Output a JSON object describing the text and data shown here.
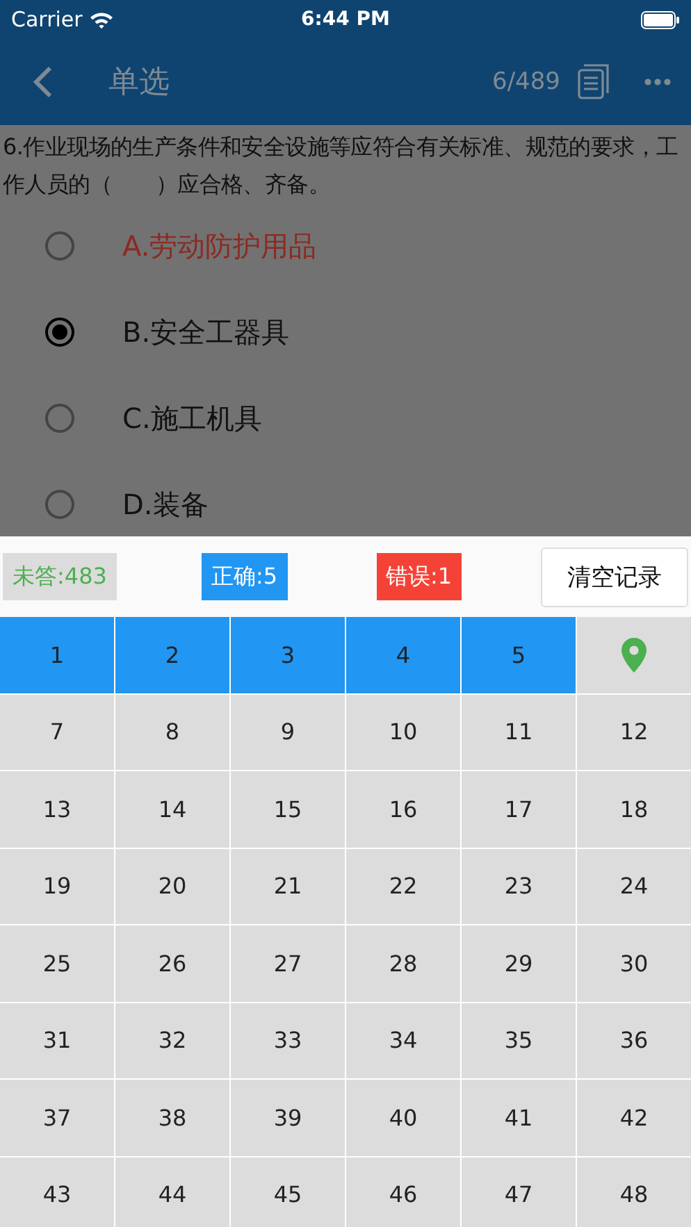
{
  "status_bar": {
    "carrier": "Carrier",
    "time": "6:44 PM"
  },
  "nav": {
    "title": "单选",
    "progress": "6/489"
  },
  "question": {
    "text": "6.作业现场的生产条件和安全设施等应符合有关标准、规范的要求，工作人员的（　　）应合格、齐备。",
    "options": [
      {
        "label": "A.劳动防护用品",
        "selected": false,
        "marked": true
      },
      {
        "label": "B.安全工器具",
        "selected": true,
        "marked": false
      },
      {
        "label": "C.施工机具",
        "selected": false,
        "marked": false
      },
      {
        "label": "D.装备",
        "selected": false,
        "marked": false
      }
    ]
  },
  "stats": [
    {
      "kind": "unanswered",
      "text": "未答:483"
    },
    {
      "kind": "correct",
      "text": "正确:5"
    },
    {
      "kind": "wrong",
      "text": "错误:1"
    }
  ],
  "clear_button": "清空记录",
  "cells": [
    {
      "kind": "correct",
      "label": "1"
    },
    {
      "kind": "correct",
      "label": "2"
    },
    {
      "kind": "correct",
      "label": "3"
    },
    {
      "kind": "correct",
      "label": "4"
    },
    {
      "kind": "correct",
      "label": "5"
    },
    {
      "kind": "current"
    },
    {
      "kind": "unanswered",
      "label": "7"
    },
    {
      "kind": "unanswered",
      "label": "8"
    },
    {
      "kind": "unanswered",
      "label": "9"
    },
    {
      "kind": "unanswered",
      "label": "10"
    },
    {
      "kind": "unanswered",
      "label": "11"
    },
    {
      "kind": "unanswered",
      "label": "12"
    },
    {
      "kind": "unanswered",
      "label": "13"
    },
    {
      "kind": "unanswered",
      "label": "14"
    },
    {
      "kind": "unanswered",
      "label": "15"
    },
    {
      "kind": "unanswered",
      "label": "16"
    },
    {
      "kind": "unanswered",
      "label": "17"
    },
    {
      "kind": "unanswered",
      "label": "18"
    },
    {
      "kind": "unanswered",
      "label": "19"
    },
    {
      "kind": "unanswered",
      "label": "20"
    },
    {
      "kind": "unanswered",
      "label": "21"
    },
    {
      "kind": "unanswered",
      "label": "22"
    },
    {
      "kind": "unanswered",
      "label": "23"
    },
    {
      "kind": "unanswered",
      "label": "24"
    },
    {
      "kind": "unanswered",
      "label": "25"
    },
    {
      "kind": "unanswered",
      "label": "26"
    },
    {
      "kind": "unanswered",
      "label": "27"
    },
    {
      "kind": "unanswered",
      "label": "28"
    },
    {
      "kind": "unanswered",
      "label": "29"
    },
    {
      "kind": "unanswered",
      "label": "30"
    },
    {
      "kind": "unanswered",
      "label": "31"
    },
    {
      "kind": "unanswered",
      "label": "32"
    },
    {
      "kind": "unanswered",
      "label": "33"
    },
    {
      "kind": "unanswered",
      "label": "34"
    },
    {
      "kind": "unanswered",
      "label": "35"
    },
    {
      "kind": "unanswered",
      "label": "36"
    },
    {
      "kind": "unanswered",
      "label": "37"
    },
    {
      "kind": "unanswered",
      "label": "38"
    },
    {
      "kind": "unanswered",
      "label": "39"
    },
    {
      "kind": "unanswered",
      "label": "40"
    },
    {
      "kind": "unanswered",
      "label": "41"
    },
    {
      "kind": "unanswered",
      "label": "42"
    },
    {
      "kind": "unanswered",
      "label": "43"
    },
    {
      "kind": "unanswered",
      "label": "44"
    },
    {
      "kind": "unanswered",
      "label": "45"
    },
    {
      "kind": "unanswered",
      "label": "46"
    },
    {
      "kind": "unanswered",
      "label": "47"
    },
    {
      "kind": "unanswered",
      "label": "48"
    }
  ]
}
